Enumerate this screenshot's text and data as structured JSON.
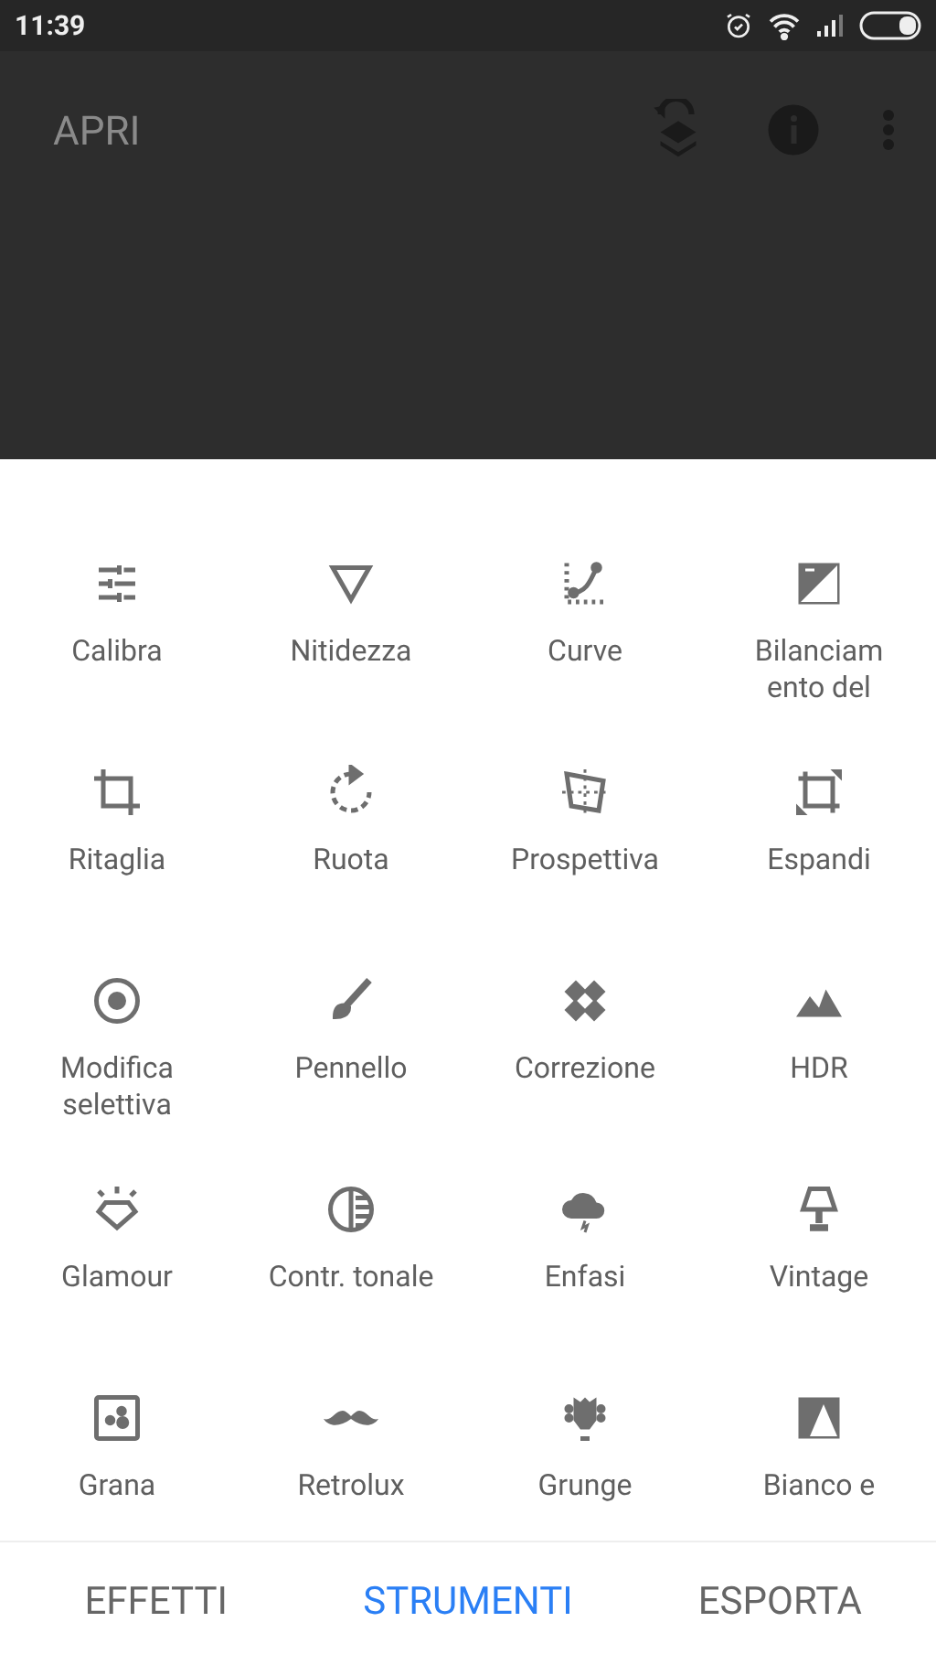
{
  "status_bar": {
    "time": "11:39"
  },
  "toolbar": {
    "title": "APRI"
  },
  "tools": [
    {
      "label": [
        "Calibra"
      ]
    },
    {
      "label": [
        "Nitidezza"
      ]
    },
    {
      "label": [
        "Curve"
      ]
    },
    {
      "label": [
        "Bilanciam",
        "ento del"
      ]
    },
    {
      "label": [
        "Ritaglia"
      ]
    },
    {
      "label": [
        "Ruota"
      ]
    },
    {
      "label": [
        "Prospettiva"
      ]
    },
    {
      "label": [
        "Espandi"
      ]
    },
    {
      "label": [
        "Modifica",
        "selettiva"
      ]
    },
    {
      "label": [
        "Pennello"
      ]
    },
    {
      "label": [
        "Correzione"
      ]
    },
    {
      "label": [
        "HDR"
      ]
    },
    {
      "label": [
        "Glamour"
      ]
    },
    {
      "label": [
        "Contr. tonale"
      ]
    },
    {
      "label": [
        "Enfasi"
      ]
    },
    {
      "label": [
        "Vintage"
      ]
    },
    {
      "label": [
        "Grana"
      ]
    },
    {
      "label": [
        "Retrolux"
      ]
    },
    {
      "label": [
        "Grunge"
      ]
    },
    {
      "label": [
        "Bianco e"
      ]
    }
  ],
  "tabs": [
    {
      "label": "EFFETTI",
      "selected": false
    },
    {
      "label": "STRUMENTI",
      "selected": true
    },
    {
      "label": "ESPORTA",
      "selected": false
    }
  ]
}
